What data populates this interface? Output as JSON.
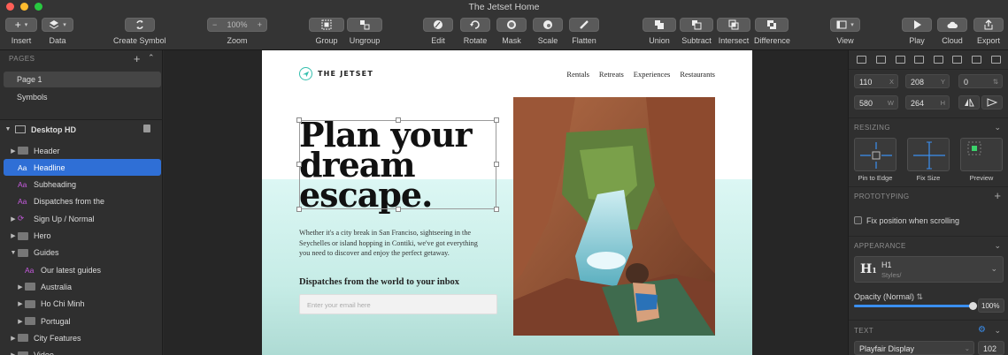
{
  "window": {
    "title": "The Jetset Home"
  },
  "toolbar": {
    "insert": "Insert",
    "data": "Data",
    "create_symbol": "Create Symbol",
    "zoom_value": "100%",
    "zoom_minus": "−",
    "zoom_plus": "+",
    "zoom": "Zoom",
    "group": "Group",
    "ungroup": "Ungroup",
    "edit": "Edit",
    "rotate": "Rotate",
    "mask": "Mask",
    "scale": "Scale",
    "flatten": "Flatten",
    "union": "Union",
    "subtract": "Subtract",
    "intersect": "Intersect",
    "difference": "Difference",
    "view": "View",
    "play": "Play",
    "cloud": "Cloud",
    "export": "Export"
  },
  "sidebar": {
    "pages_header": "PAGES",
    "pages": [
      "Page 1",
      "Symbols"
    ],
    "artboard": "Desktop HD",
    "layers": [
      {
        "label": "Header",
        "kind": "folder",
        "indent": 0
      },
      {
        "label": "Headline",
        "kind": "text",
        "indent": 0,
        "selected": true
      },
      {
        "label": "Subheading",
        "kind": "text",
        "indent": 0
      },
      {
        "label": "Dispatches from the",
        "kind": "text",
        "indent": 0
      },
      {
        "label": "Sign Up / Normal",
        "kind": "symbol",
        "indent": 0
      },
      {
        "label": "Hero",
        "kind": "folder",
        "indent": 0
      },
      {
        "label": "Guides",
        "kind": "folder",
        "indent": 0,
        "open": true
      },
      {
        "label": "Our latest guides",
        "kind": "text",
        "indent": 1
      },
      {
        "label": "Australia",
        "kind": "folder",
        "indent": 1
      },
      {
        "label": "Ho Chi Minh",
        "kind": "folder",
        "indent": 1
      },
      {
        "label": "Portugal",
        "kind": "folder",
        "indent": 1
      },
      {
        "label": "City Features",
        "kind": "folder",
        "indent": 0
      },
      {
        "label": "Video",
        "kind": "folder",
        "indent": 0
      }
    ]
  },
  "artboard": {
    "logo": "THE JETSET",
    "nav": [
      "Rentals",
      "Retreats",
      "Experiences",
      "Restaurants"
    ],
    "headline": [
      "Plan your",
      "dream",
      "escape."
    ],
    "subheading": [
      "Whether it's a city break in San Franciso, sightseeing in the",
      "Seychelles or island hopping in Contiki, we've got everything",
      "you need to discover and enjoy the perfect getaway."
    ],
    "dispatch_title": "Dispatches from the world to your inbox",
    "email_placeholder": "Enter your email here"
  },
  "inspector": {
    "x": "110",
    "y": "208",
    "rotation": "0",
    "w": "580",
    "h": "264",
    "x_label": "X",
    "y_label": "Y",
    "w_label": "W",
    "h_label": "H",
    "resizing": "RESIZING",
    "pin_to_edge": "Pin to Edge",
    "fix_size": "Fix Size",
    "preview": "Preview",
    "prototyping": "PROTOTYPING",
    "fix_position": "Fix position when scrolling",
    "appearance": "APPEARANCE",
    "style_name": "H1",
    "style_group": "Styles/",
    "opacity_label": "Opacity (Normal)",
    "opacity_value": "100%",
    "text": "TEXT",
    "font": "Playfair Display",
    "font_size": "102"
  },
  "colors": {
    "selection": "#2f6fd6",
    "accent_teal": "#35bfae",
    "hero_bg": "#dcf7f4"
  }
}
